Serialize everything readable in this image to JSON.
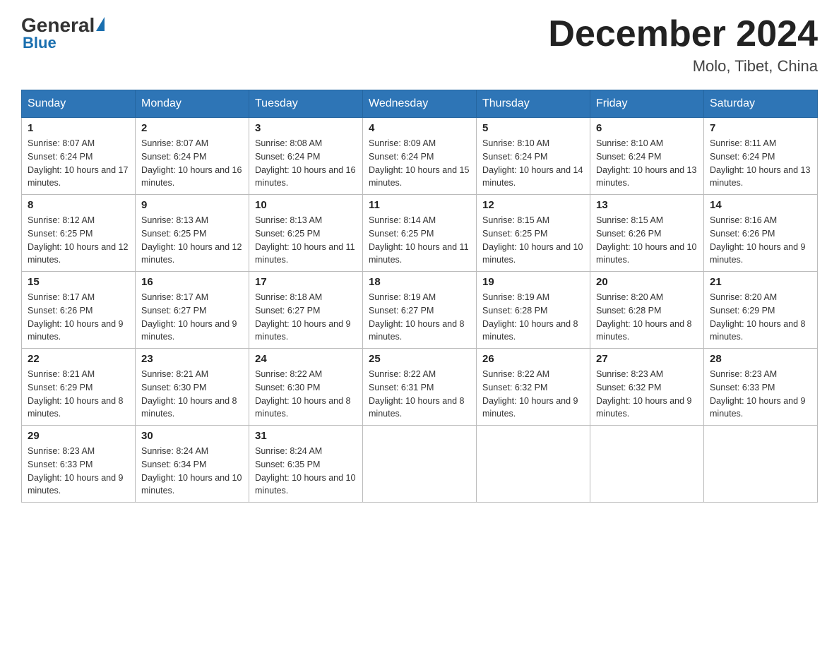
{
  "header": {
    "logo_general": "General",
    "logo_blue": "Blue",
    "month_title": "December 2024",
    "location": "Molo, Tibet, China"
  },
  "days_of_week": [
    "Sunday",
    "Monday",
    "Tuesday",
    "Wednesday",
    "Thursday",
    "Friday",
    "Saturday"
  ],
  "weeks": [
    [
      {
        "day": "1",
        "sunrise": "8:07 AM",
        "sunset": "6:24 PM",
        "daylight": "10 hours and 17 minutes."
      },
      {
        "day": "2",
        "sunrise": "8:07 AM",
        "sunset": "6:24 PM",
        "daylight": "10 hours and 16 minutes."
      },
      {
        "day": "3",
        "sunrise": "8:08 AM",
        "sunset": "6:24 PM",
        "daylight": "10 hours and 16 minutes."
      },
      {
        "day": "4",
        "sunrise": "8:09 AM",
        "sunset": "6:24 PM",
        "daylight": "10 hours and 15 minutes."
      },
      {
        "day": "5",
        "sunrise": "8:10 AM",
        "sunset": "6:24 PM",
        "daylight": "10 hours and 14 minutes."
      },
      {
        "day": "6",
        "sunrise": "8:10 AM",
        "sunset": "6:24 PM",
        "daylight": "10 hours and 13 minutes."
      },
      {
        "day": "7",
        "sunrise": "8:11 AM",
        "sunset": "6:24 PM",
        "daylight": "10 hours and 13 minutes."
      }
    ],
    [
      {
        "day": "8",
        "sunrise": "8:12 AM",
        "sunset": "6:25 PM",
        "daylight": "10 hours and 12 minutes."
      },
      {
        "day": "9",
        "sunrise": "8:13 AM",
        "sunset": "6:25 PM",
        "daylight": "10 hours and 12 minutes."
      },
      {
        "day": "10",
        "sunrise": "8:13 AM",
        "sunset": "6:25 PM",
        "daylight": "10 hours and 11 minutes."
      },
      {
        "day": "11",
        "sunrise": "8:14 AM",
        "sunset": "6:25 PM",
        "daylight": "10 hours and 11 minutes."
      },
      {
        "day": "12",
        "sunrise": "8:15 AM",
        "sunset": "6:25 PM",
        "daylight": "10 hours and 10 minutes."
      },
      {
        "day": "13",
        "sunrise": "8:15 AM",
        "sunset": "6:26 PM",
        "daylight": "10 hours and 10 minutes."
      },
      {
        "day": "14",
        "sunrise": "8:16 AM",
        "sunset": "6:26 PM",
        "daylight": "10 hours and 9 minutes."
      }
    ],
    [
      {
        "day": "15",
        "sunrise": "8:17 AM",
        "sunset": "6:26 PM",
        "daylight": "10 hours and 9 minutes."
      },
      {
        "day": "16",
        "sunrise": "8:17 AM",
        "sunset": "6:27 PM",
        "daylight": "10 hours and 9 minutes."
      },
      {
        "day": "17",
        "sunrise": "8:18 AM",
        "sunset": "6:27 PM",
        "daylight": "10 hours and 9 minutes."
      },
      {
        "day": "18",
        "sunrise": "8:19 AM",
        "sunset": "6:27 PM",
        "daylight": "10 hours and 8 minutes."
      },
      {
        "day": "19",
        "sunrise": "8:19 AM",
        "sunset": "6:28 PM",
        "daylight": "10 hours and 8 minutes."
      },
      {
        "day": "20",
        "sunrise": "8:20 AM",
        "sunset": "6:28 PM",
        "daylight": "10 hours and 8 minutes."
      },
      {
        "day": "21",
        "sunrise": "8:20 AM",
        "sunset": "6:29 PM",
        "daylight": "10 hours and 8 minutes."
      }
    ],
    [
      {
        "day": "22",
        "sunrise": "8:21 AM",
        "sunset": "6:29 PM",
        "daylight": "10 hours and 8 minutes."
      },
      {
        "day": "23",
        "sunrise": "8:21 AM",
        "sunset": "6:30 PM",
        "daylight": "10 hours and 8 minutes."
      },
      {
        "day": "24",
        "sunrise": "8:22 AM",
        "sunset": "6:30 PM",
        "daylight": "10 hours and 8 minutes."
      },
      {
        "day": "25",
        "sunrise": "8:22 AM",
        "sunset": "6:31 PM",
        "daylight": "10 hours and 8 minutes."
      },
      {
        "day": "26",
        "sunrise": "8:22 AM",
        "sunset": "6:32 PM",
        "daylight": "10 hours and 9 minutes."
      },
      {
        "day": "27",
        "sunrise": "8:23 AM",
        "sunset": "6:32 PM",
        "daylight": "10 hours and 9 minutes."
      },
      {
        "day": "28",
        "sunrise": "8:23 AM",
        "sunset": "6:33 PM",
        "daylight": "10 hours and 9 minutes."
      }
    ],
    [
      {
        "day": "29",
        "sunrise": "8:23 AM",
        "sunset": "6:33 PM",
        "daylight": "10 hours and 9 minutes."
      },
      {
        "day": "30",
        "sunrise": "8:24 AM",
        "sunset": "6:34 PM",
        "daylight": "10 hours and 10 minutes."
      },
      {
        "day": "31",
        "sunrise": "8:24 AM",
        "sunset": "6:35 PM",
        "daylight": "10 hours and 10 minutes."
      },
      null,
      null,
      null,
      null
    ]
  ],
  "labels": {
    "sunrise": "Sunrise:",
    "sunset": "Sunset:",
    "daylight": "Daylight:"
  }
}
